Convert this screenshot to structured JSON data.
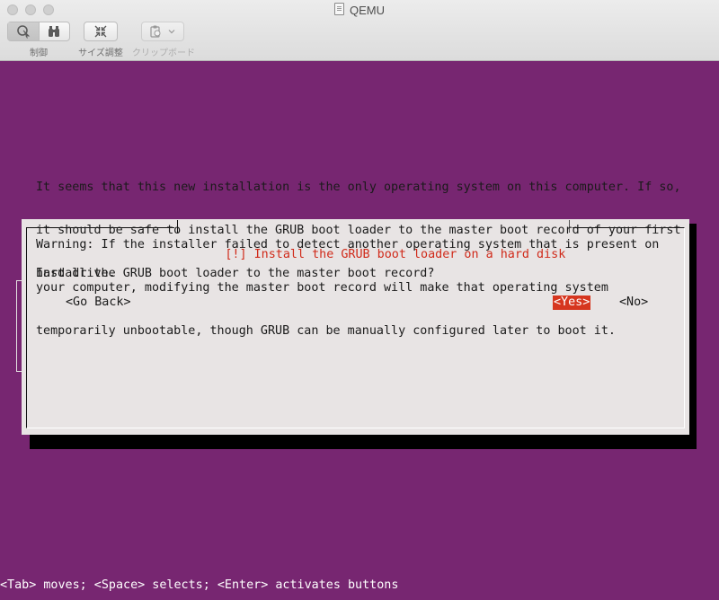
{
  "window": {
    "title": "QEMU",
    "doc_icon": "document-icon"
  },
  "toolbar": {
    "control_label": "制御",
    "resize_label": "サイズ調整",
    "clipboard_label": "クリップボード",
    "icons": [
      "pointer-capture-icon",
      "binoculars-icon",
      "resize-arrows-icon",
      "clipboard-icon",
      "chevron-down-icon"
    ]
  },
  "dialog": {
    "title": "[!] Install the GRUB boot loader on a hard disk",
    "para1": [
      "It seems that this new installation is the only operating system on this computer. If so,",
      "it should be safe to install the GRUB boot loader to the master boot record of your first",
      "hard drive."
    ],
    "para2": [
      "Warning: If the installer failed to detect another operating system that is present on",
      "your computer, modifying the master boot record will make that operating system",
      "temporarily unbootable, though GRUB can be manually configured later to boot it."
    ],
    "question": "Install the GRUB boot loader to the master boot record?",
    "buttons": {
      "go_back": "<Go Back>",
      "yes": "<Yes>",
      "no": "<No>"
    }
  },
  "statusbar": {
    "text": "<Tab> moves; <Space> selects; <Enter> activates buttons"
  },
  "colors": {
    "background": "#772671",
    "dialog": "#e8e4e4",
    "title_text": "#d02a1a",
    "selected_button": "#d6361f"
  }
}
